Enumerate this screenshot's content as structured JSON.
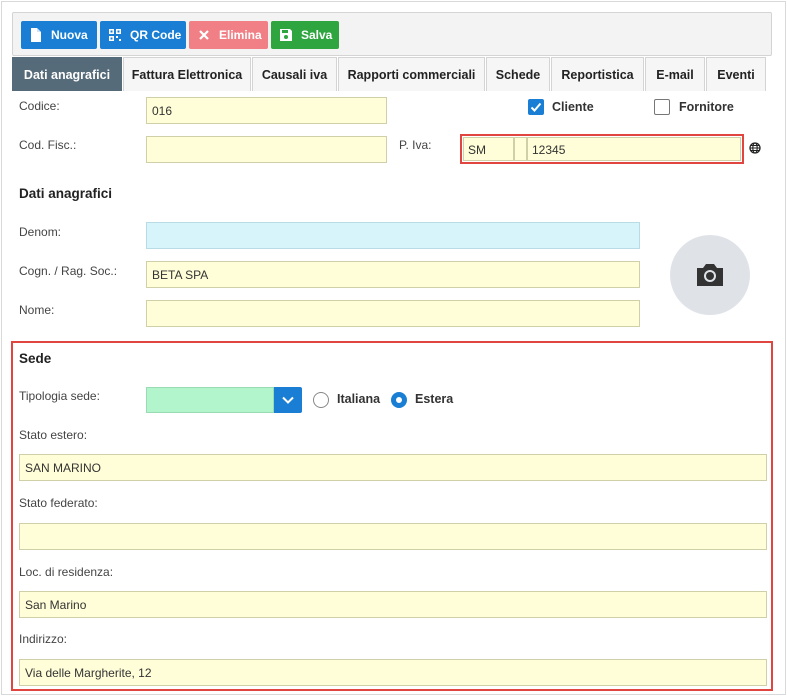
{
  "toolbar": {
    "nuova": "Nuova",
    "qr_code": "QR Code",
    "elimina": "Elimina",
    "salva": "Salva"
  },
  "tabs": [
    {
      "label": "Dati anagrafici",
      "active": true
    },
    {
      "label": "Fattura Elettronica"
    },
    {
      "label": "Causali iva"
    },
    {
      "label": "Rapporti commerciali"
    },
    {
      "label": "Schede"
    },
    {
      "label": "Reportistica"
    },
    {
      "label": "E-mail"
    },
    {
      "label": "Eventi"
    }
  ],
  "form": {
    "codice_label": "Codice:",
    "codice_value": "016",
    "cliente_label": "Cliente",
    "cliente_checked": true,
    "fornitore_label": "Fornitore",
    "fornitore_checked": false,
    "cod_fisc_label": "Cod. Fisc.:",
    "cod_fisc_value": "",
    "piva_label": "P. Iva:",
    "piva_country": "SM",
    "piva_value": "12345"
  },
  "dati_anagrafici": {
    "title": "Dati anagrafici",
    "denom_label": "Denom:",
    "denom_value": "",
    "cognome_label": "Cogn. / Rag. Soc.:",
    "cognome_value": "BETA SPA",
    "nome_label": "Nome:",
    "nome_value": ""
  },
  "sede": {
    "title": "Sede",
    "tipologia_label": "Tipologia sede:",
    "tipologia_value": "",
    "italiana_label": "Italiana",
    "estera_label": "Estera",
    "selected": "Estera",
    "stato_estero_label": "Stato estero:",
    "stato_estero_value": "SAN MARINO",
    "stato_federato_label": "Stato federato:",
    "stato_federato_value": "",
    "localita_label": "Loc. di residenza:",
    "localita_value": "San Marino",
    "indirizzo_label": "Indirizzo:",
    "indirizzo_value": "Via delle Margherite, 12"
  },
  "colors": {
    "primary": "#1a7fd4",
    "danger": "#f07f86",
    "success": "#2fa53f",
    "active_tab": "#566b7a",
    "highlight": "#e0453f",
    "input_yellow": "#fffed8"
  },
  "icons": [
    "file-icon",
    "qr-code-icon",
    "close-icon",
    "save-icon",
    "globe-icon",
    "camera-icon",
    "chevron-down-icon",
    "checkmark-icon"
  ]
}
